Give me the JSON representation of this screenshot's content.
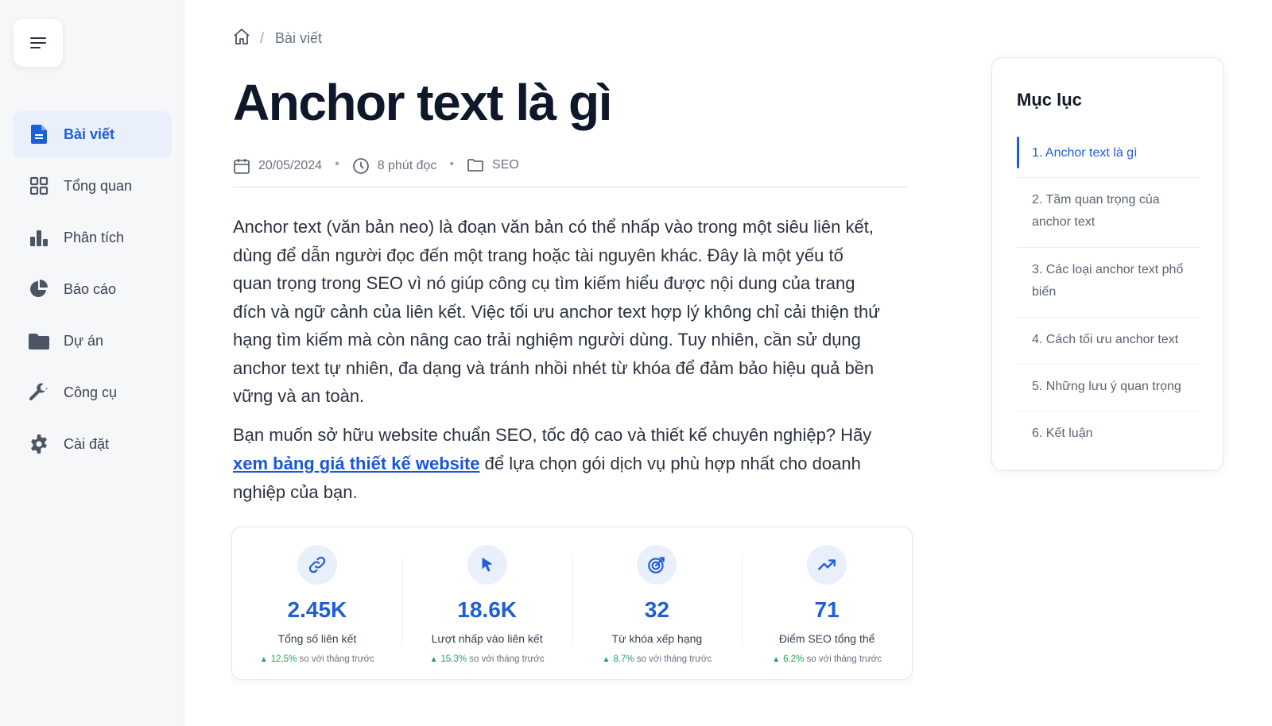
{
  "sidebar": {
    "menu_icon": "hamburger-icon",
    "items": [
      {
        "label": "Bài viết",
        "icon": "document-icon",
        "active": true
      },
      {
        "label": "Tổng quan",
        "icon": "grid-icon"
      },
      {
        "label": "Phân tích",
        "icon": "bar-chart-icon"
      },
      {
        "label": "Báo cáo",
        "icon": "pie-chart-icon"
      },
      {
        "label": "Dự án",
        "icon": "folder-icon"
      },
      {
        "label": "Công cụ",
        "icon": "wrench-icon"
      },
      {
        "label": "Cài đặt",
        "icon": "gear-icon"
      }
    ]
  },
  "breadcrumb": {
    "separator": "/",
    "current": "Bài viết"
  },
  "article": {
    "title": "Anchor text là gì",
    "date": "20/05/2024",
    "read_time": "8 phút đọc",
    "category": "SEO",
    "paragraph1": "Anchor text (văn bản neo) là đoạn văn bản có thể nhấp vào trong một siêu liên kết, dùng để dẫn người đọc đến một trang hoặc tài nguyên khác. Đây là một yếu tố quan trọng trong SEO vì nó giúp công cụ tìm kiếm hiểu được nội dung của trang đích và ngữ cảnh của liên kết. Việc tối ưu anchor text hợp lý không chỉ cải thiện thứ hạng tìm kiếm mà còn nâng cao trải nghiệm người dùng. Tuy nhiên, cần sử dụng anchor text tự nhiên, đa dạng và tránh nhồi nhét từ khóa để đảm bảo hiệu quả bền vững và an toàn.",
    "cta_before": "Bạn muốn sở hữu website chuẩn SEO, tốc độ cao và thiết kế chuyên nghiệp? Hãy ",
    "cta_link": "xem bảng giá thiết kế website",
    "cta_after": " để lựa chọn gói dịch vụ phù hợp nhất cho doanh nghiệp của bạn."
  },
  "stats": [
    {
      "icon": "link-icon",
      "value": "2.45K",
      "label": "Tổng số liên kết",
      "change": "12.5%",
      "suffix": "so với tháng trước"
    },
    {
      "icon": "cursor-icon",
      "value": "18.6K",
      "label": "Lượt nhấp vào liên kết",
      "change": "15.3%",
      "suffix": "so với tháng trước"
    },
    {
      "icon": "target-icon",
      "value": "32",
      "label": "Từ khóa xếp hạng",
      "change": "8.7%",
      "suffix": "so với tháng trước"
    },
    {
      "icon": "trend-up-icon",
      "value": "71",
      "label": "Điểm SEO tổng thể",
      "change": "6.2%",
      "suffix": "so với tháng trước"
    }
  ],
  "toc": {
    "title": "Mục lục",
    "items": [
      "1. Anchor text là gì",
      "2. Tầm quan trọng của anchor text",
      "3. Các loại anchor text phổ biến",
      "4. Cách tối ưu anchor text",
      "5. Những lưu ý quan trọng",
      "6. Kết luận"
    ]
  },
  "colors": {
    "accent": "#1f5fd6",
    "positive": "#22a559",
    "sidebar_bg": "#f6f7f9"
  }
}
